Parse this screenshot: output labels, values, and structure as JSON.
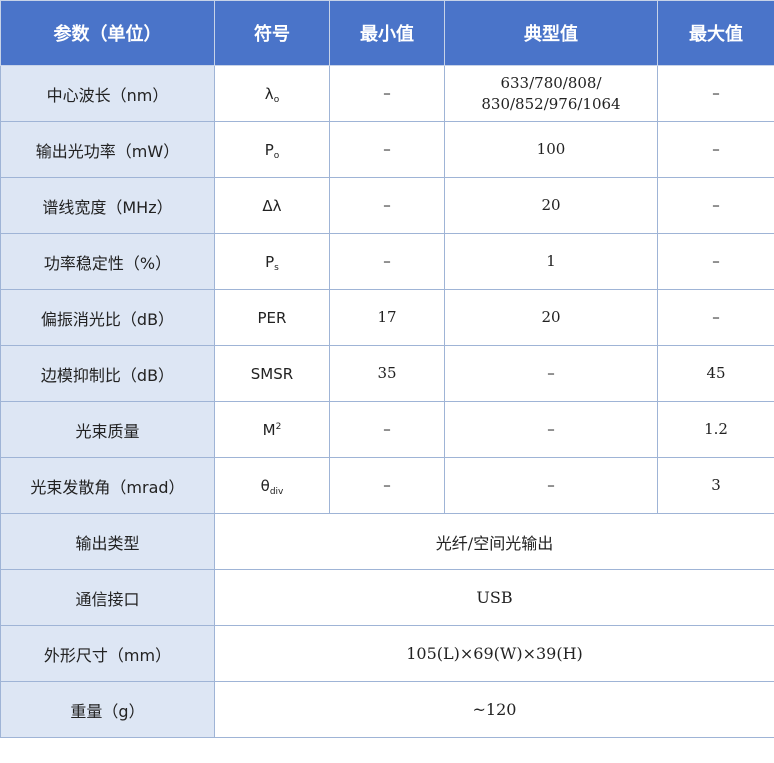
{
  "header": {
    "param": "参数（单位）",
    "symbol": "符号",
    "min": "最小值",
    "typ": "典型值",
    "max": "最大值"
  },
  "rows": [
    {
      "param": "中心波长（nm）",
      "sym_base": "λ",
      "sym_sub": "o",
      "min": "–",
      "typ_line1": "633/780/808/",
      "typ_line2": "830/852/976/1064",
      "max": "–"
    },
    {
      "param": "输出光功率（mW）",
      "sym_base": "P",
      "sym_sub": "o",
      "min": "–",
      "typ": "100",
      "max": "–"
    },
    {
      "param": "谱线宽度（MHz）",
      "sym": "Δλ",
      "min": "–",
      "typ": "20",
      "max": "–"
    },
    {
      "param": "功率稳定性（%）",
      "sym_base": "P",
      "sym_sub": "s",
      "min": "–",
      "typ": "1",
      "max": "–"
    },
    {
      "param": "偏振消光比（dB）",
      "sym": "PER",
      "min": "17",
      "typ": "20",
      "max": "–"
    },
    {
      "param": "边模抑制比（dB）",
      "sym": "SMSR",
      "min": "35",
      "typ": "–",
      "max": "45"
    },
    {
      "param": "光束质量",
      "sym_base": "M",
      "sym_sup": "2",
      "min": "–",
      "typ": "–",
      "max": "1.2"
    },
    {
      "param": "光束发散角（mrad）",
      "sym_base": "θ",
      "sym_sub": "div",
      "min": "–",
      "typ": "–",
      "max": "3"
    },
    {
      "param": "输出类型",
      "value": "光纤/空间光输出"
    },
    {
      "param": "通信接口",
      "value": "USB"
    },
    {
      "param": "外形尺寸（mm）",
      "value": "105(L)×69(W)×39(H)"
    },
    {
      "param": "重量（g）",
      "value": "~120"
    }
  ]
}
